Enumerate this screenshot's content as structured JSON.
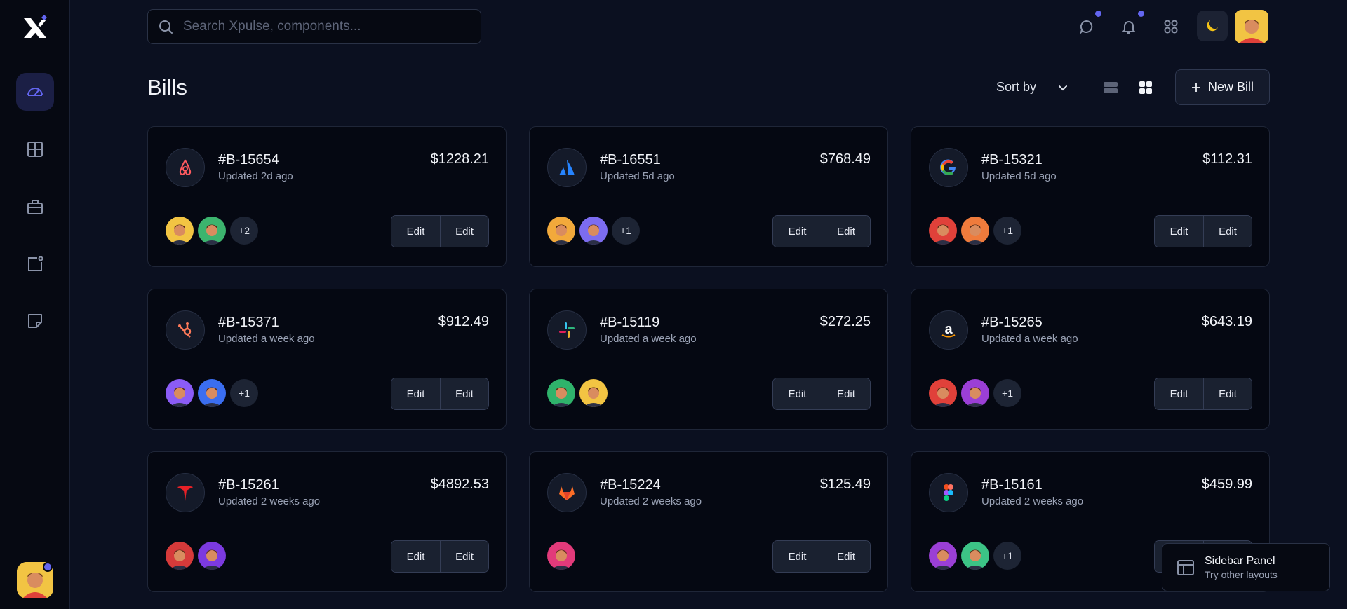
{
  "app": {
    "logo": "xpulse-logo"
  },
  "search": {
    "placeholder": "Search Xpulse, components..."
  },
  "sidebar": {
    "items": [
      {
        "icon": "speedometer-icon",
        "active": true
      },
      {
        "icon": "grid-icon",
        "active": false
      },
      {
        "icon": "briefcase-icon",
        "active": false
      },
      {
        "icon": "notification-square-icon",
        "active": false
      },
      {
        "icon": "sticky-note-icon",
        "active": false
      }
    ]
  },
  "header": {
    "title": "Bills",
    "sort_label": "Sort by",
    "new_bill_label": "New Bill"
  },
  "bills": [
    {
      "id": "#B-15654",
      "updated": "Updated 2d ago",
      "amount": "$1228.21",
      "brand": "airbnb",
      "more": "+2",
      "avatars": [
        "#f2c443",
        "#3cb46e"
      ],
      "actions": [
        "Edit",
        "Edit"
      ]
    },
    {
      "id": "#B-16551",
      "updated": "Updated 5d ago",
      "amount": "$768.49",
      "brand": "atlassian",
      "more": "+1",
      "avatars": [
        "#f2a93b",
        "#7c6cf0"
      ],
      "actions": [
        "Edit",
        "Edit"
      ]
    },
    {
      "id": "#B-15321",
      "updated": "Updated 5d ago",
      "amount": "$112.31",
      "brand": "google",
      "more": "+1",
      "avatars": [
        "#e0413a",
        "#ef7b3c"
      ],
      "actions": [
        "Edit",
        "Edit"
      ]
    },
    {
      "id": "#B-15371",
      "updated": "Updated a week ago",
      "amount": "$912.49",
      "brand": "hubspot",
      "more": "+1",
      "avatars": [
        "#8b5cf6",
        "#3b6ef0"
      ],
      "actions": [
        "Edit",
        "Edit"
      ]
    },
    {
      "id": "#B-15119",
      "updated": "Updated a week ago",
      "amount": "$272.25",
      "brand": "slack",
      "more": "",
      "avatars": [
        "#2fb36b",
        "#f2c443"
      ],
      "actions": [
        "Edit",
        "Edit"
      ]
    },
    {
      "id": "#B-15265",
      "updated": "Updated a week ago",
      "amount": "$643.19",
      "brand": "amazon",
      "more": "+1",
      "avatars": [
        "#e0413a",
        "#9b3fd6"
      ],
      "actions": [
        "Edit",
        "Edit"
      ]
    },
    {
      "id": "#B-15261",
      "updated": "Updated 2 weeks ago",
      "amount": "$4892.53",
      "brand": "tesla",
      "more": "",
      "avatars": [
        "#d63a3a",
        "#7c3ae0"
      ],
      "actions": [
        "Edit",
        "Edit"
      ]
    },
    {
      "id": "#B-15224",
      "updated": "Updated 2 weeks ago",
      "amount": "$125.49",
      "brand": "gitlab",
      "more": "",
      "avatars": [
        "#e23a7a"
      ],
      "actions": [
        "Edit",
        "Edit"
      ]
    },
    {
      "id": "#B-15161",
      "updated": "Updated 2 weeks ago",
      "amount": "$459.99",
      "brand": "figma",
      "more": "+1",
      "avatars": [
        "#9b3fd6",
        "#3cc486"
      ],
      "actions": [
        "Edit",
        "Edit"
      ]
    }
  ],
  "panel": {
    "title": "Sidebar Panel",
    "subtitle": "Try other layouts"
  },
  "colors": {
    "accent": "#6366f1",
    "background": "#0b1020",
    "card": "#050812"
  }
}
